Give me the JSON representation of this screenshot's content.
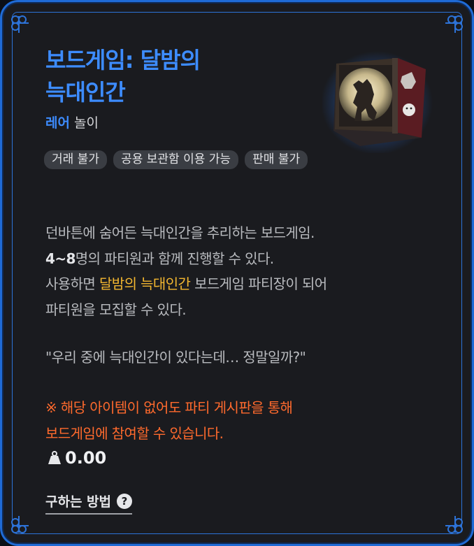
{
  "item": {
    "title_line1": "보드게임: 달밤의",
    "title_line2": "늑대인간",
    "grade": "레어",
    "category": "놀이",
    "icon": "werewolf-boardgame-box-icon"
  },
  "tags": [
    "거래 불가",
    "공용 보관함 이용 가능",
    "판매 불가"
  ],
  "description": {
    "line1": "던바튼에 숨어든 늑대인간을 추리하는 보드게임.",
    "line2_num": "4~8",
    "line2_text": "명의 파티원과 함께 진행할 수 있다.",
    "line3_pre": "사용하면 ",
    "line3_highlight": "달밤의 늑대인간",
    "line3_post": " 보드게임 파티장이 되어",
    "line4": "파티원을 모집할 수 있다."
  },
  "quote": "\"우리 중에 늑대인간이 있다는데… 정말일까?\"",
  "notice": {
    "line1": "※ 해당 아이템이 없어도 파티 게시판을 통해",
    "line2": "보드게임에 참여할 수 있습니다."
  },
  "weight": {
    "icon": "weight-icon",
    "value": "0.00"
  },
  "how_to_obtain": {
    "label": "구하는 방법",
    "icon": "question-icon",
    "icon_text": "?"
  },
  "colors": {
    "frame": "#1f6bd6",
    "title": "#3d8cff",
    "highlight": "#f2b630",
    "notice": "#ff6a2d",
    "background": "#1a1b1f"
  }
}
